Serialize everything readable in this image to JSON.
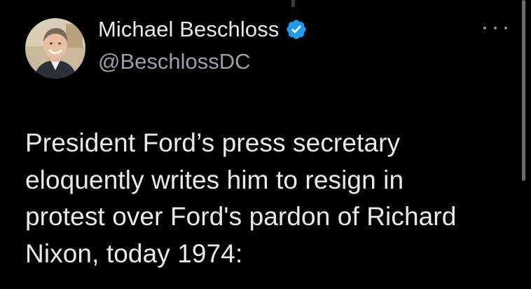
{
  "tweet": {
    "author": {
      "display_name": "Michael Beschloss",
      "handle": "@BeschlossDC",
      "verified": true
    },
    "text_lines": [
      "President Ford’s press secretary",
      "eloquently writes him to resign in",
      "protest over Ford's pardon of Richard",
      "Nixon, today 1974:"
    ]
  },
  "icons": {
    "verified": "verified-badge-icon",
    "more": "more-options-icon"
  },
  "colors": {
    "background": "#000000",
    "text_primary": "#e7e9ea",
    "text_secondary": "#9aa0a6",
    "verified_blue": "#1d9bf0"
  }
}
